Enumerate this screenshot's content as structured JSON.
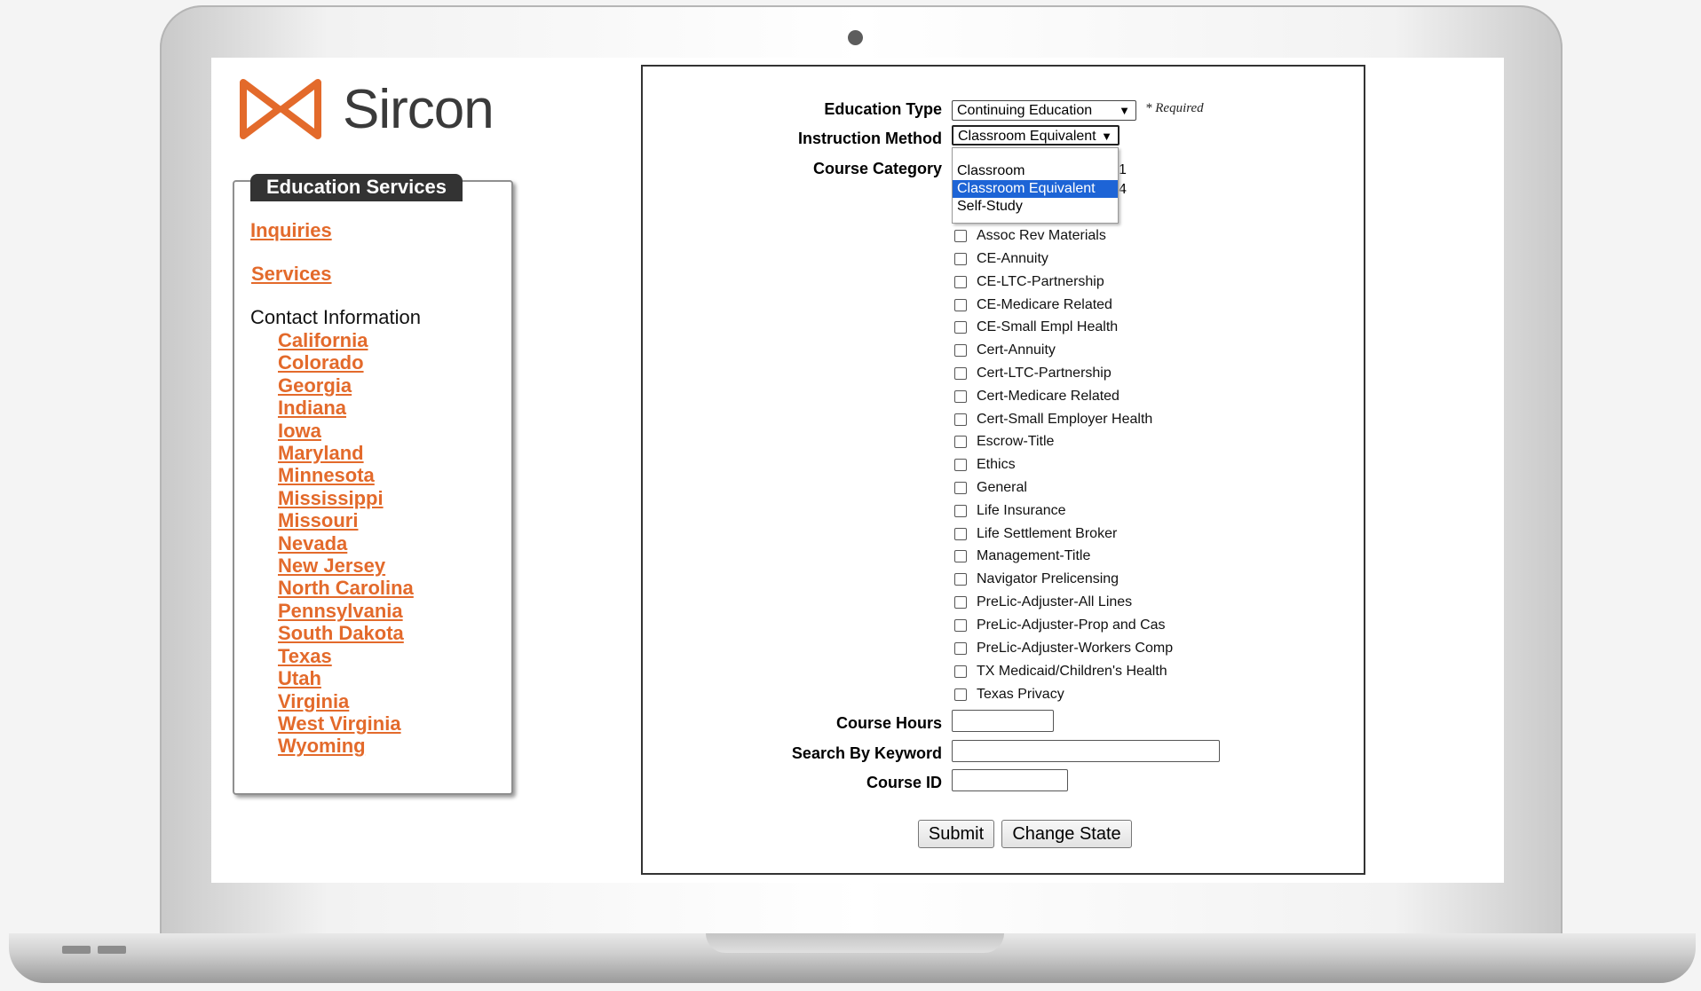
{
  "brand": {
    "name": "Sircon",
    "accent": "#e36a2b"
  },
  "sidebar": {
    "title": "Education Services",
    "links": [
      {
        "label": "Inquiries"
      },
      {
        "label": "Services"
      }
    ],
    "contact_heading": "Contact Information",
    "states": [
      "California",
      "Colorado",
      "Georgia",
      "Indiana",
      "Iowa",
      "Maryland",
      "Minnesota",
      "Mississippi",
      "Missouri",
      "Nevada",
      "New Jersey",
      "North Carolina",
      "Pennsylvania",
      "South Dakota",
      "Texas",
      "Utah",
      "Virginia",
      "West Virginia",
      "Wyoming"
    ]
  },
  "form": {
    "education_type": {
      "label": "Education Type",
      "value": "Continuing Education",
      "required_note": "* Required"
    },
    "instruction_method": {
      "label": "Instruction Method",
      "value": "Classroom Equivalent",
      "options": [
        "Classroom",
        "Classroom Equivalent",
        "Self-Study"
      ],
      "selected_index": 1
    },
    "course_category": {
      "label": "Course Category",
      "hidden_fragments": [
        "1",
        "4",
        "Assoc Rev Materials"
      ],
      "options": [
        "Assoc Rev Materials",
        "CE-Annuity",
        "CE-LTC-Partnership",
        "CE-Medicare Related",
        "CE-Small Empl Health",
        "Cert-Annuity",
        "Cert-LTC-Partnership",
        "Cert-Medicare Related",
        "Cert-Small Employer Health",
        "Escrow-Title",
        "Ethics",
        "General",
        "Life Insurance",
        "Life Settlement Broker",
        "Management-Title",
        "Navigator Prelicensing",
        "PreLic-Adjuster-All Lines",
        "PreLic-Adjuster-Prop and Cas",
        "PreLic-Adjuster-Workers Comp",
        "TX Medicaid/Children's Health",
        "Texas Privacy"
      ]
    },
    "course_hours": {
      "label": "Course Hours",
      "value": ""
    },
    "keyword": {
      "label": "Search By Keyword",
      "value": ""
    },
    "course_id": {
      "label": "Course ID",
      "value": ""
    },
    "buttons": {
      "submit": "Submit",
      "change_state": "Change State"
    }
  }
}
